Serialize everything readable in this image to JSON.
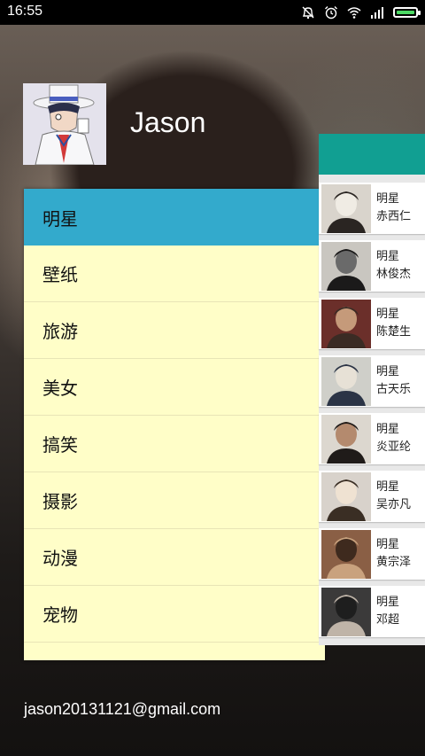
{
  "status_bar": {
    "time": "16:55",
    "icons": [
      "mute-icon",
      "alarm-icon",
      "wifi-icon",
      "signal-icon",
      "battery-icon"
    ],
    "battery_level": 1.0,
    "battery_color": "#4cd964"
  },
  "user": {
    "name": "Jason",
    "email": "jason20131121@gmail.com"
  },
  "menu": {
    "active_color": "#33aacc",
    "background": "#fffec8",
    "items": [
      {
        "label": "明星",
        "active": true
      },
      {
        "label": "壁纸",
        "active": false
      },
      {
        "label": "旅游",
        "active": false
      },
      {
        "label": "美女",
        "active": false
      },
      {
        "label": "搞笑",
        "active": false
      },
      {
        "label": "摄影",
        "active": false
      },
      {
        "label": "动漫",
        "active": false
      },
      {
        "label": "宠物",
        "active": false
      }
    ]
  },
  "content": {
    "header_color": "#119f92",
    "cards": [
      {
        "category": "明星",
        "name": "赤西仁"
      },
      {
        "category": "明星",
        "name": "林俊杰"
      },
      {
        "category": "明星",
        "name": "陈楚生"
      },
      {
        "category": "明星",
        "name": "古天乐"
      },
      {
        "category": "明星",
        "name": "炎亚纶"
      },
      {
        "category": "明星",
        "name": "吴亦凡"
      },
      {
        "category": "明星",
        "name": "黄宗泽"
      },
      {
        "category": "明星",
        "name": "邓超"
      }
    ]
  }
}
